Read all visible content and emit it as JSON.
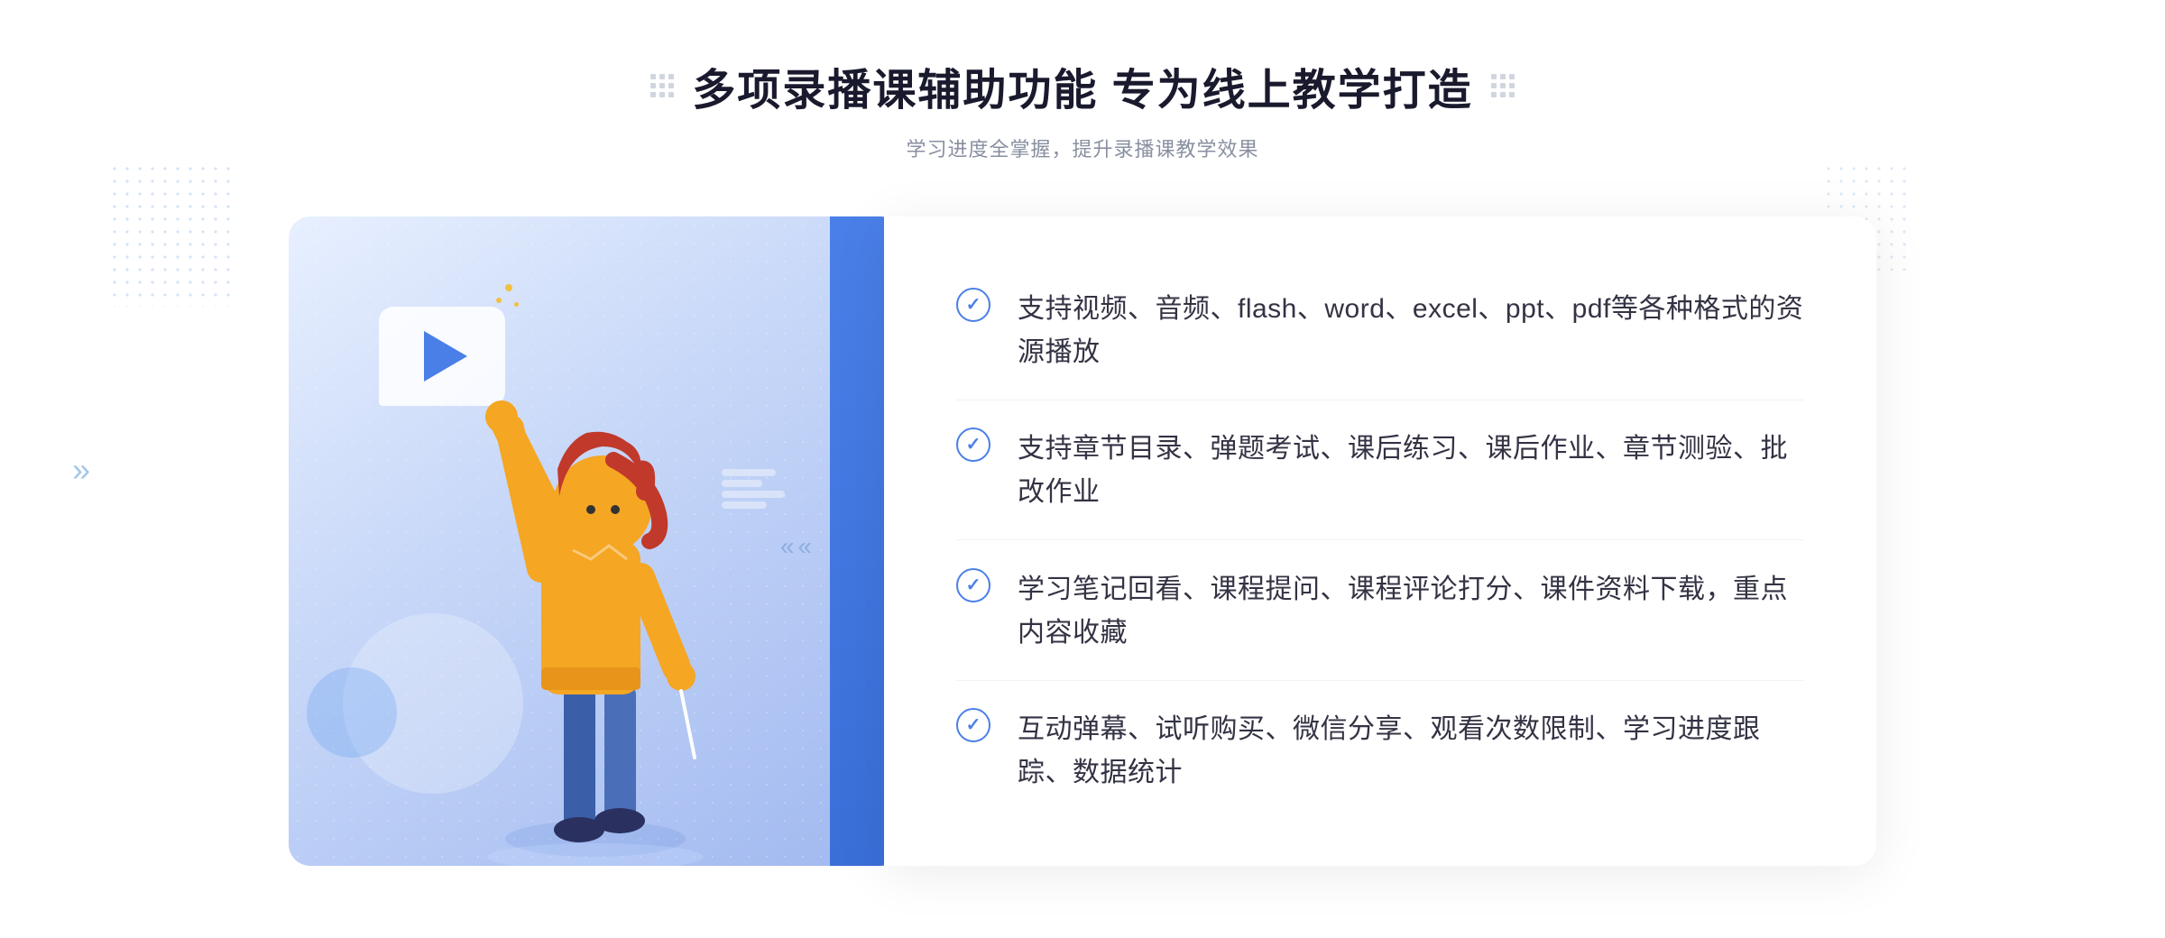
{
  "header": {
    "main_title": "多项录播课辅助功能 专为线上教学打造",
    "sub_title": "学习进度全掌握，提升录播课教学效果"
  },
  "features": [
    {
      "id": "feature-1",
      "text": "支持视频、音频、flash、word、excel、ppt、pdf等各种格式的资源播放"
    },
    {
      "id": "feature-2",
      "text": "支持章节目录、弹题考试、课后练习、课后作业、章节测验、批改作业"
    },
    {
      "id": "feature-3",
      "text": "学习笔记回看、课程提问、课程评论打分、课件资料下载，重点内容收藏"
    },
    {
      "id": "feature-4",
      "text": "互动弹幕、试听购买、微信分享、观看次数限制、学习进度跟踪、数据统计"
    }
  ],
  "colors": {
    "accent_blue": "#4a7fe8",
    "text_dark": "#1a1a2e",
    "text_gray": "#888fa0",
    "border": "#f0f2f5"
  },
  "icons": {
    "check": "✓",
    "play": "▶",
    "chevron": "»"
  }
}
